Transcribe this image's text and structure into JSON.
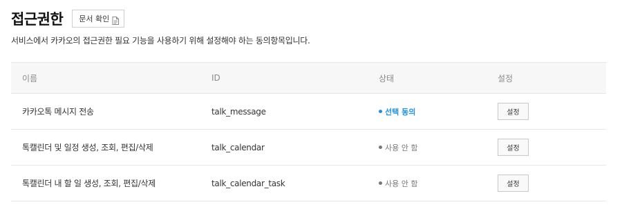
{
  "header": {
    "title": "접근권한",
    "doc_button_label": "문서 확인",
    "doc_icon": "document-icon"
  },
  "description": "서비스에서 카카오의 접근권한 필요 기능을 사용하기 위해 설정해야 하는 동의항목입니다.",
  "table": {
    "columns": [
      "이름",
      "ID",
      "상태",
      "설정"
    ],
    "rows": [
      {
        "name": "카카오톡 메시지 전송",
        "id": "talk_message",
        "status": "선택 동의",
        "status_color": "#1e90e6",
        "setting_label": "설정"
      },
      {
        "name": "톡캘린더 및 일정 생성, 조회, 편집/삭제",
        "id": "talk_calendar",
        "status": "사용 안 함",
        "status_color": "#777777",
        "setting_label": "설정"
      },
      {
        "name": "톡캘린더 내 할 일 생성, 조회, 편집/삭제",
        "id": "talk_calendar_task",
        "status": "사용 안 함",
        "status_color": "#777777",
        "setting_label": "설정"
      }
    ]
  }
}
